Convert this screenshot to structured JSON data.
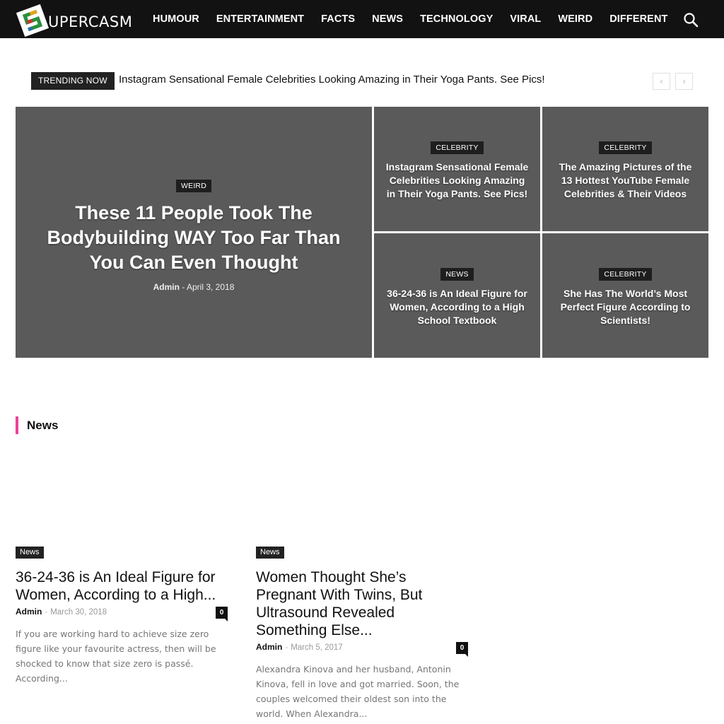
{
  "header": {
    "logo_text": "UPERCASM",
    "nav": [
      "HUMOUR",
      "ENTERTAINMENT",
      "FACTS",
      "NEWS",
      "TECHNOLOGY",
      "VIRAL",
      "WEIRD",
      "DIFFERENT"
    ],
    "search_icon": "search-icon"
  },
  "trending": {
    "label": "TRENDING NOW",
    "headline": "Instagram Sensational Female Celebrities Looking Amazing in Their Yoga Pants. See Pics!",
    "prev_symbol": "‹",
    "next_symbol": "›"
  },
  "featured": {
    "main": {
      "category": "WEIRD",
      "title": "These 11 People Took The Bodybuilding WAY Too Far Than You Can Even Thought",
      "author": "Admin",
      "date": "April 3, 2018"
    },
    "tiles": [
      {
        "category": "CELEBRITY",
        "title": "Instagram Sensational Female Celebrities Looking Amazing in Their Yoga Pants. See Pics!"
      },
      {
        "category": "CELEBRITY",
        "title": "The Amazing Pictures of the 13 Hottest YouTube Female Celebrities & Their Videos"
      },
      {
        "category": "NEWS",
        "title": "36-24-36 is An Ideal Figure for Women, According to a High School Textbook"
      },
      {
        "category": "CELEBRITY",
        "title": "She Has The World’s Most Perfect Figure According to Scientists!"
      }
    ]
  },
  "section": {
    "title": "News",
    "accent_color": "#ef3f9b"
  },
  "articles": [
    {
      "category": "News",
      "title": "36-24-36 is An Ideal Figure for Women, According to a High...",
      "author": "Admin",
      "date": "March 30, 2018",
      "comments": "0",
      "excerpt": "If you are working hard to achieve size zero figure like your favourite actress, then will be shocked to know that size zero is passé. According..."
    },
    {
      "category": "News",
      "title": "Women Thought She’s Pregnant With Twins, But Ultrasound Revealed Something Else...",
      "author": "Admin",
      "date": "March 5, 2017",
      "comments": "0",
      "excerpt": "Alexandra Kinova and her husband, Antonin Kinova, fell in love and got married. Soon, the couples welcomed their oldest son into the world. When Alexandra..."
    }
  ]
}
